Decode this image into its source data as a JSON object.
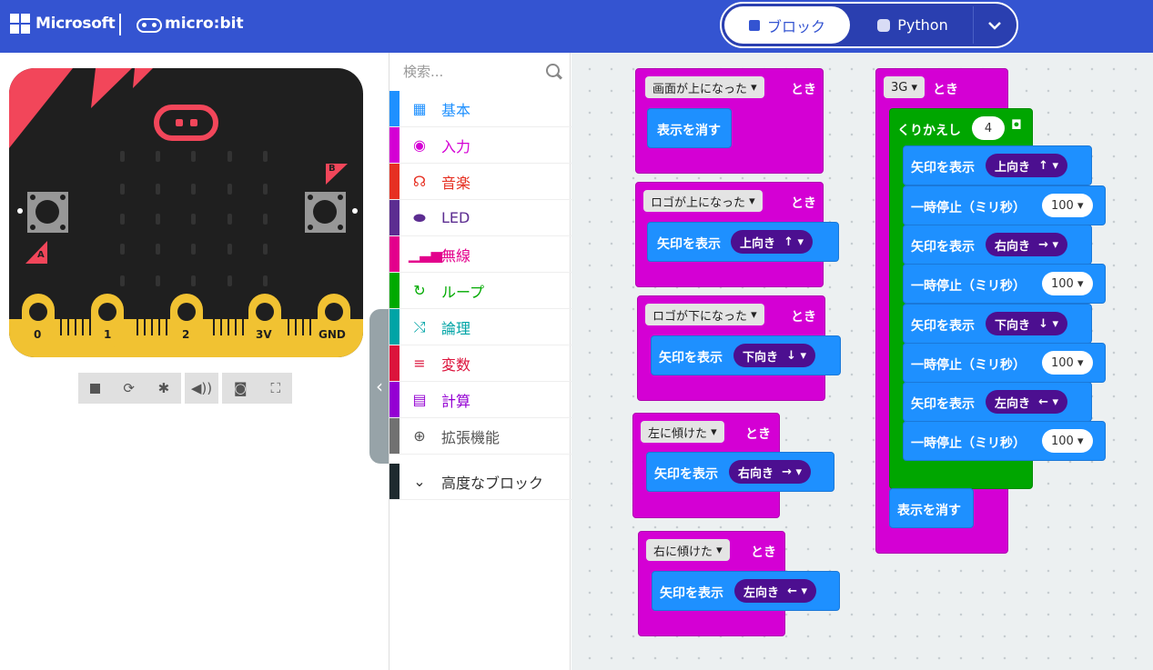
{
  "header": {
    "microsoft_label": "Microsoft",
    "microbit_label": "micro:bit",
    "tab_blocks": "ブロック",
    "tab_python": "Python"
  },
  "simulator": {
    "pin_labels": [
      "0",
      "1",
      "2",
      "3V",
      "GND"
    ],
    "button_a": "A",
    "button_b": "B"
  },
  "toolbox": {
    "search_placeholder": "検索...",
    "categories": [
      {
        "label": "基本",
        "color": "#1e90ff",
        "icon": "grid-icon"
      },
      {
        "label": "入力",
        "color": "#d400d4",
        "icon": "target-icon"
      },
      {
        "label": "音楽",
        "color": "#e63022",
        "icon": "headphones-icon"
      },
      {
        "label": "LED",
        "color": "#5c2d91",
        "icon": "toggle-icon"
      },
      {
        "label": "無線",
        "color": "#e3008c",
        "icon": "signal-icon"
      },
      {
        "label": "ループ",
        "color": "#00aa00",
        "icon": "refresh-icon"
      },
      {
        "label": "論理",
        "color": "#00a4a6",
        "icon": "shuffle-icon"
      },
      {
        "label": "変数",
        "color": "#dc143c",
        "icon": "list-icon"
      },
      {
        "label": "計算",
        "color": "#9400d3",
        "icon": "calculator-icon"
      },
      {
        "label": "拡張機能",
        "color": "#717171",
        "icon": "plus-circle-icon"
      }
    ],
    "advanced": "高度なブロック"
  },
  "workspace": {
    "when": "とき",
    "show_arrow": "矢印を表示",
    "clear_screen": "表示を消す",
    "pause_ms": "一時停止（ミリ秒）",
    "repeat": "くりかえし",
    "repeat_count": "4",
    "pause_value": "100",
    "events": {
      "screen_up": "画面が上になった",
      "logo_up": "ロゴが上になった",
      "logo_down": "ロゴが下になった",
      "tilt_left": "左に傾けた",
      "tilt_right": "右に傾けた",
      "shake_3g": "3G"
    },
    "arrows": {
      "up": "上向き",
      "up_glyph": "↑",
      "down": "下向き",
      "down_glyph": "↓",
      "right": "右向き",
      "right_glyph": "→",
      "left": "左向き",
      "left_glyph": "←"
    }
  }
}
